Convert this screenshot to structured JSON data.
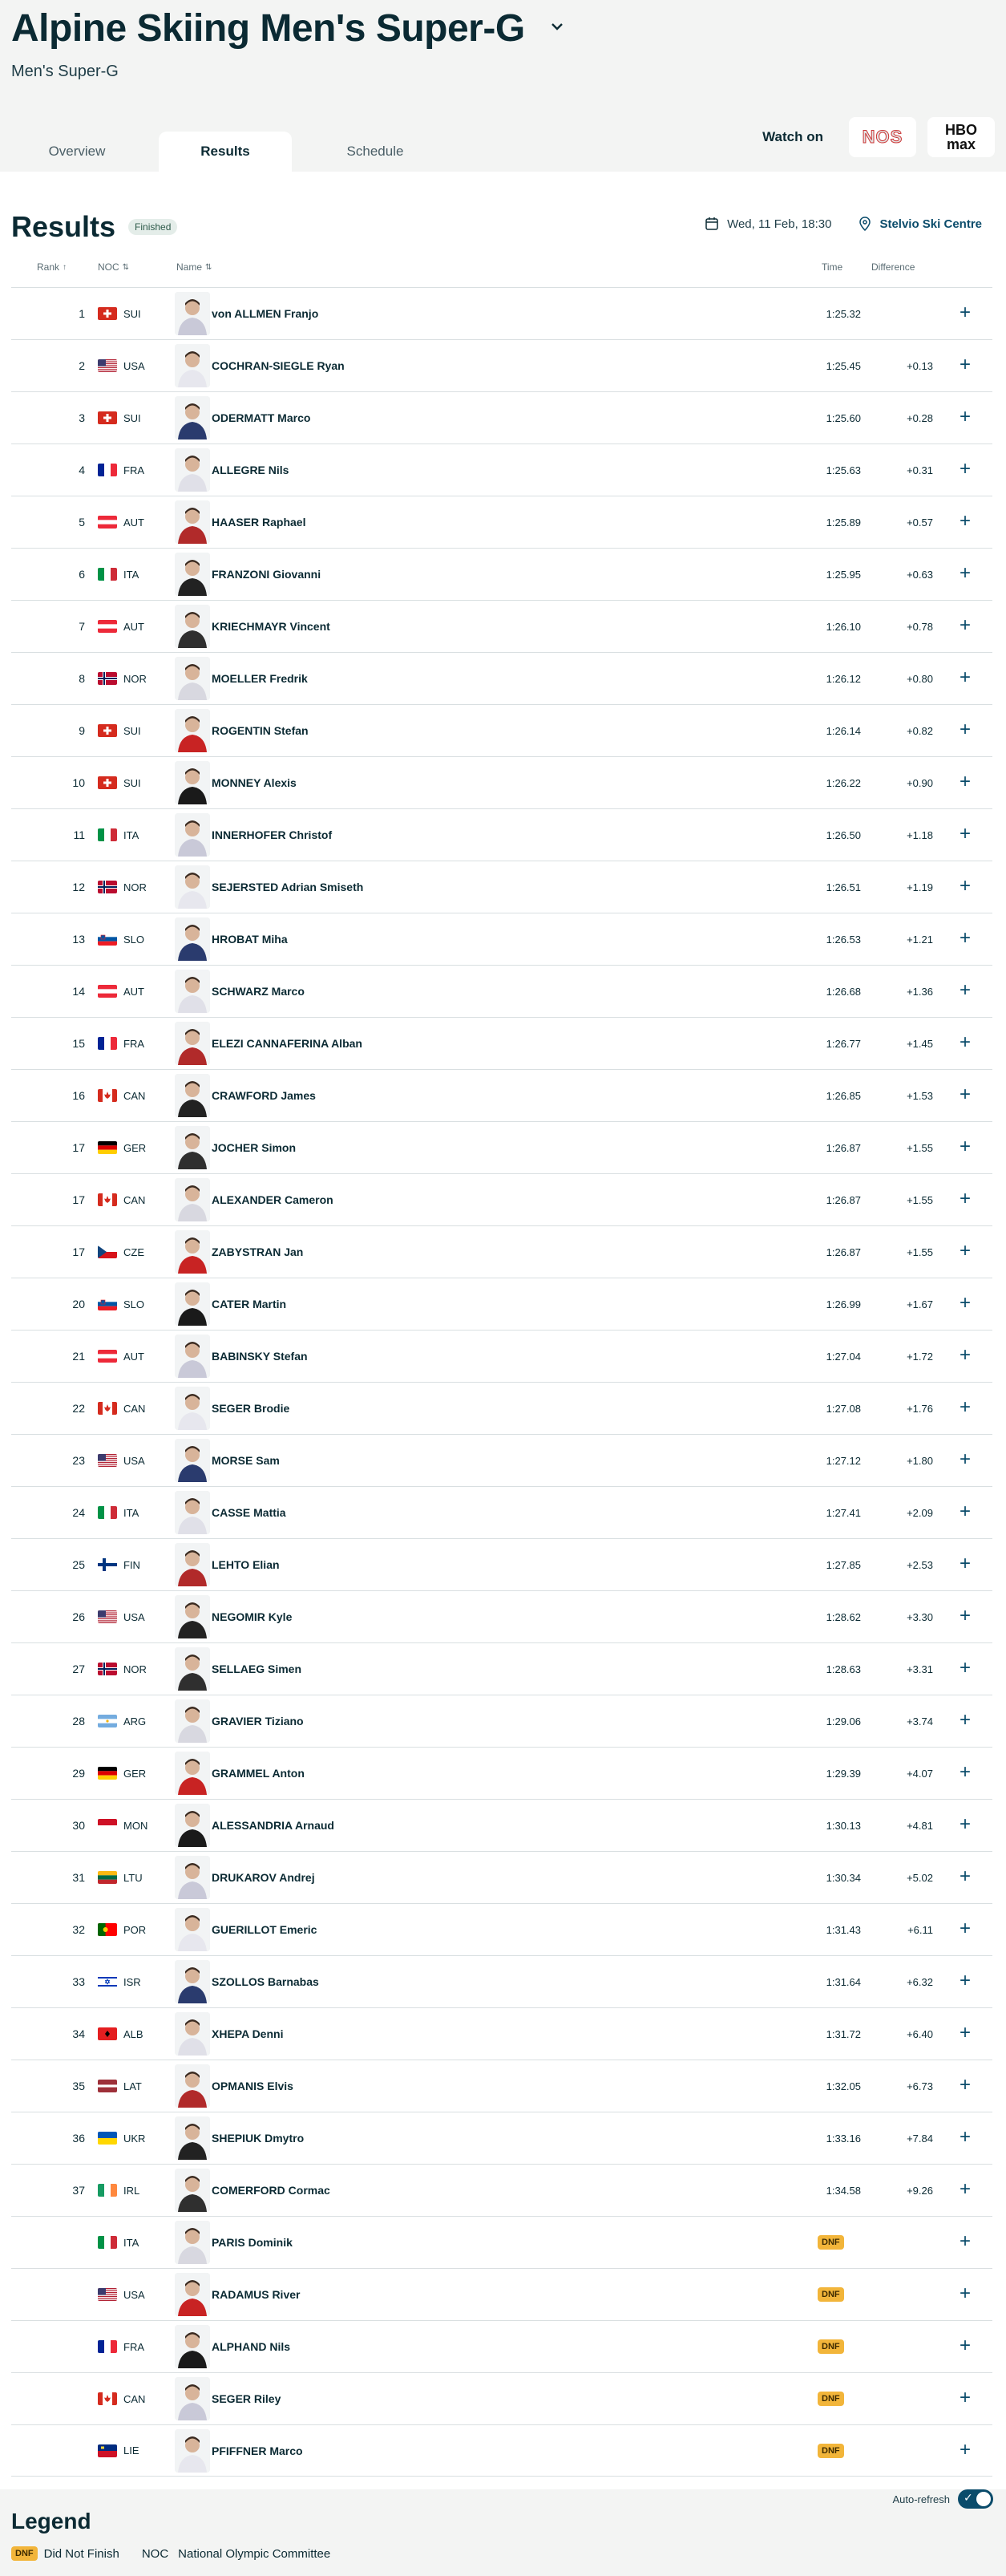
{
  "header": {
    "title": "Alpine Skiing Men's Super-G",
    "subtitle": "Men's Super-G"
  },
  "tabs": [
    {
      "label": "Overview"
    },
    {
      "label": "Results"
    },
    {
      "label": "Schedule"
    }
  ],
  "watch": {
    "label": "Watch on",
    "providers": [
      "NOS",
      "HBO max"
    ]
  },
  "results": {
    "title": "Results",
    "status": "Finished",
    "datetime": "Wed, 11 Feb, 18:30",
    "venue": "Stelvio Ski Centre",
    "columns": {
      "rank": "Rank",
      "noc": "NOC",
      "name": "Name",
      "time": "Time",
      "difference": "Difference"
    },
    "rows": [
      {
        "rank": "1",
        "noc": "SUI",
        "name": "von ALLMEN Franjo",
        "time": "1:25.32",
        "diff": ""
      },
      {
        "rank": "2",
        "noc": "USA",
        "name": "COCHRAN-SIEGLE Ryan",
        "time": "1:25.45",
        "diff": "+0.13"
      },
      {
        "rank": "3",
        "noc": "SUI",
        "name": "ODERMATT Marco",
        "time": "1:25.60",
        "diff": "+0.28"
      },
      {
        "rank": "4",
        "noc": "FRA",
        "name": "ALLEGRE Nils",
        "time": "1:25.63",
        "diff": "+0.31"
      },
      {
        "rank": "5",
        "noc": "AUT",
        "name": "HAASER Raphael",
        "time": "1:25.89",
        "diff": "+0.57"
      },
      {
        "rank": "6",
        "noc": "ITA",
        "name": "FRANZONI Giovanni",
        "time": "1:25.95",
        "diff": "+0.63"
      },
      {
        "rank": "7",
        "noc": "AUT",
        "name": "KRIECHMAYR Vincent",
        "time": "1:26.10",
        "diff": "+0.78"
      },
      {
        "rank": "8",
        "noc": "NOR",
        "name": "MOELLER Fredrik",
        "time": "1:26.12",
        "diff": "+0.80"
      },
      {
        "rank": "9",
        "noc": "SUI",
        "name": "ROGENTIN Stefan",
        "time": "1:26.14",
        "diff": "+0.82"
      },
      {
        "rank": "10",
        "noc": "SUI",
        "name": "MONNEY Alexis",
        "time": "1:26.22",
        "diff": "+0.90"
      },
      {
        "rank": "11",
        "noc": "ITA",
        "name": "INNERHOFER Christof",
        "time": "1:26.50",
        "diff": "+1.18"
      },
      {
        "rank": "12",
        "noc": "NOR",
        "name": "SEJERSTED Adrian Smiseth",
        "time": "1:26.51",
        "diff": "+1.19"
      },
      {
        "rank": "13",
        "noc": "SLO",
        "name": "HROBAT Miha",
        "time": "1:26.53",
        "diff": "+1.21"
      },
      {
        "rank": "14",
        "noc": "AUT",
        "name": "SCHWARZ Marco",
        "time": "1:26.68",
        "diff": "+1.36"
      },
      {
        "rank": "15",
        "noc": "FRA",
        "name": "ELEZI CANNAFERINA Alban",
        "time": "1:26.77",
        "diff": "+1.45"
      },
      {
        "rank": "16",
        "noc": "CAN",
        "name": "CRAWFORD James",
        "time": "1:26.85",
        "diff": "+1.53"
      },
      {
        "rank": "17",
        "noc": "GER",
        "name": "JOCHER Simon",
        "time": "1:26.87",
        "diff": "+1.55"
      },
      {
        "rank": "17",
        "noc": "CAN",
        "name": "ALEXANDER Cameron",
        "time": "1:26.87",
        "diff": "+1.55"
      },
      {
        "rank": "17",
        "noc": "CZE",
        "name": "ZABYSTRAN Jan",
        "time": "1:26.87",
        "diff": "+1.55"
      },
      {
        "rank": "20",
        "noc": "SLO",
        "name": "CATER Martin",
        "time": "1:26.99",
        "diff": "+1.67"
      },
      {
        "rank": "21",
        "noc": "AUT",
        "name": "BABINSKY Stefan",
        "time": "1:27.04",
        "diff": "+1.72"
      },
      {
        "rank": "22",
        "noc": "CAN",
        "name": "SEGER Brodie",
        "time": "1:27.08",
        "diff": "+1.76"
      },
      {
        "rank": "23",
        "noc": "USA",
        "name": "MORSE Sam",
        "time": "1:27.12",
        "diff": "+1.80"
      },
      {
        "rank": "24",
        "noc": "ITA",
        "name": "CASSE Mattia",
        "time": "1:27.41",
        "diff": "+2.09"
      },
      {
        "rank": "25",
        "noc": "FIN",
        "name": "LEHTO Elian",
        "time": "1:27.85",
        "diff": "+2.53"
      },
      {
        "rank": "26",
        "noc": "USA",
        "name": "NEGOMIR Kyle",
        "time": "1:28.62",
        "diff": "+3.30"
      },
      {
        "rank": "27",
        "noc": "NOR",
        "name": "SELLAEG Simen",
        "time": "1:28.63",
        "diff": "+3.31"
      },
      {
        "rank": "28",
        "noc": "ARG",
        "name": "GRAVIER Tiziano",
        "time": "1:29.06",
        "diff": "+3.74"
      },
      {
        "rank": "29",
        "noc": "GER",
        "name": "GRAMMEL Anton",
        "time": "1:29.39",
        "diff": "+4.07"
      },
      {
        "rank": "30",
        "noc": "MON",
        "name": "ALESSANDRIA Arnaud",
        "time": "1:30.13",
        "diff": "+4.81"
      },
      {
        "rank": "31",
        "noc": "LTU",
        "name": "DRUKAROV Andrej",
        "time": "1:30.34",
        "diff": "+5.02"
      },
      {
        "rank": "32",
        "noc": "POR",
        "name": "GUERILLOT Emeric",
        "time": "1:31.43",
        "diff": "+6.11"
      },
      {
        "rank": "33",
        "noc": "ISR",
        "name": "SZOLLOS Barnabas",
        "time": "1:31.64",
        "diff": "+6.32"
      },
      {
        "rank": "34",
        "noc": "ALB",
        "name": "XHEPA Denni",
        "time": "1:31.72",
        "diff": "+6.40"
      },
      {
        "rank": "35",
        "noc": "LAT",
        "name": "OPMANIS Elvis",
        "time": "1:32.05",
        "diff": "+6.73"
      },
      {
        "rank": "36",
        "noc": "UKR",
        "name": "SHEPIUK Dmytro",
        "time": "1:33.16",
        "diff": "+7.84"
      },
      {
        "rank": "37",
        "noc": "IRL",
        "name": "COMERFORD Cormac",
        "time": "1:34.58",
        "diff": "+9.26"
      },
      {
        "rank": "",
        "noc": "ITA",
        "name": "PARIS Dominik",
        "time": "DNF",
        "diff": ""
      },
      {
        "rank": "",
        "noc": "USA",
        "name": "RADAMUS River",
        "time": "DNF",
        "diff": ""
      },
      {
        "rank": "",
        "noc": "FRA",
        "name": "ALPHAND Nils",
        "time": "DNF",
        "diff": ""
      },
      {
        "rank": "",
        "noc": "CAN",
        "name": "SEGER Riley",
        "time": "DNF",
        "diff": ""
      },
      {
        "rank": "",
        "noc": "LIE",
        "name": "PFIFFNER Marco",
        "time": "DNF",
        "diff": ""
      }
    ]
  },
  "autorefresh": {
    "label": "Auto-refresh",
    "on": true
  },
  "legend": {
    "title": "Legend",
    "items": [
      {
        "abbr": "DNF",
        "text": "Did Not Finish"
      },
      {
        "abbr": "NOC",
        "text": "National Olympic Committee"
      }
    ]
  },
  "colors": {
    "accent": "#0b4c6b",
    "dnf": "#f2b53a",
    "text": "#0b2a33"
  }
}
